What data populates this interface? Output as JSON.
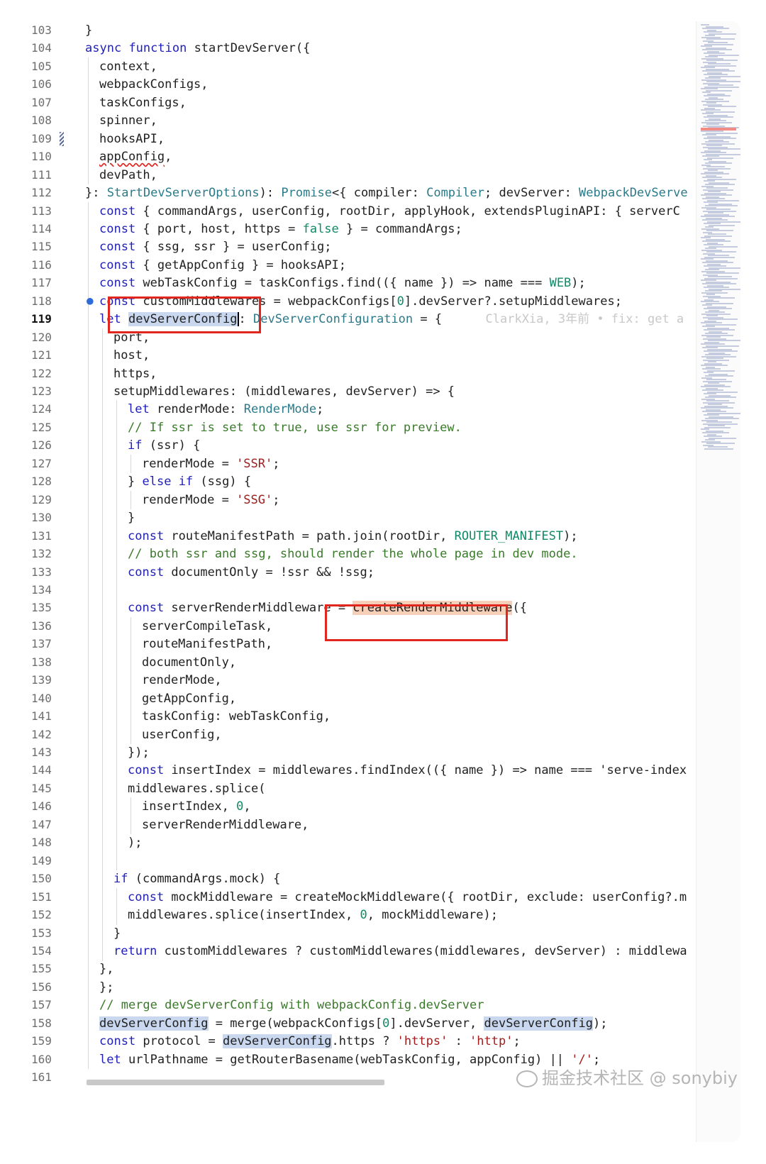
{
  "editor": {
    "active_line": 119,
    "blame": "ClarkXia, 3年前 • fix: get a",
    "lines": [
      {
        "n": 103,
        "i": 0,
        "t": "}"
      },
      {
        "n": 104,
        "i": 0,
        "t": "async function startDevServer({"
      },
      {
        "n": 105,
        "i": 1,
        "t": "context,"
      },
      {
        "n": 106,
        "i": 1,
        "t": "webpackConfigs,"
      },
      {
        "n": 107,
        "i": 1,
        "t": "taskConfigs,"
      },
      {
        "n": 108,
        "i": 1,
        "t": "spinner,"
      },
      {
        "n": 109,
        "i": 1,
        "t": "hooksAPI,"
      },
      {
        "n": 110,
        "i": 1,
        "t": "appConfig,"
      },
      {
        "n": 111,
        "i": 1,
        "t": "devPath,"
      },
      {
        "n": 112,
        "i": 0,
        "t": "}: StartDevServerOptions): Promise<{ compiler: Compiler; devServer: WebpackDevServe"
      },
      {
        "n": 113,
        "i": 1,
        "t": "const { commandArgs, userConfig, rootDir, applyHook, extendsPluginAPI: { serverC"
      },
      {
        "n": 114,
        "i": 1,
        "t": "const { port, host, https = false } = commandArgs;"
      },
      {
        "n": 115,
        "i": 1,
        "t": "const { ssg, ssr } = userConfig;"
      },
      {
        "n": 116,
        "i": 1,
        "t": "const { getAppConfig } = hooksAPI;"
      },
      {
        "n": 117,
        "i": 1,
        "t": "const webTaskConfig = taskConfigs.find(({ name }) => name === WEB);"
      },
      {
        "n": 118,
        "i": 1,
        "t": "const customMiddlewares = webpackConfigs[0].devServer?.setupMiddlewares;"
      },
      {
        "n": 119,
        "i": 1,
        "t": "let devServerConfig: DevServerConfiguration = {"
      },
      {
        "n": 120,
        "i": 2,
        "t": "port,"
      },
      {
        "n": 121,
        "i": 2,
        "t": "host,"
      },
      {
        "n": 122,
        "i": 2,
        "t": "https,"
      },
      {
        "n": 123,
        "i": 2,
        "t": "setupMiddlewares: (middlewares, devServer) => {"
      },
      {
        "n": 124,
        "i": 3,
        "t": "let renderMode: RenderMode;"
      },
      {
        "n": 125,
        "i": 3,
        "t": "// If ssr is set to true, use ssr for preview."
      },
      {
        "n": 126,
        "i": 3,
        "t": "if (ssr) {"
      },
      {
        "n": 127,
        "i": 4,
        "t": "renderMode = 'SSR';"
      },
      {
        "n": 128,
        "i": 3,
        "t": "} else if (ssg) {"
      },
      {
        "n": 129,
        "i": 4,
        "t": "renderMode = 'SSG';"
      },
      {
        "n": 130,
        "i": 3,
        "t": "}"
      },
      {
        "n": 131,
        "i": 3,
        "t": "const routeManifestPath = path.join(rootDir, ROUTER_MANIFEST);"
      },
      {
        "n": 132,
        "i": 3,
        "t": "// both ssr and ssg, should render the whole page in dev mode."
      },
      {
        "n": 133,
        "i": 3,
        "t": "const documentOnly = !ssr && !ssg;"
      },
      {
        "n": 134,
        "i": 3,
        "t": ""
      },
      {
        "n": 135,
        "i": 3,
        "t": "const serverRenderMiddleware = createRenderMiddleware({"
      },
      {
        "n": 136,
        "i": 4,
        "t": "serverCompileTask,"
      },
      {
        "n": 137,
        "i": 4,
        "t": "routeManifestPath,"
      },
      {
        "n": 138,
        "i": 4,
        "t": "documentOnly,"
      },
      {
        "n": 139,
        "i": 4,
        "t": "renderMode,"
      },
      {
        "n": 140,
        "i": 4,
        "t": "getAppConfig,"
      },
      {
        "n": 141,
        "i": 4,
        "t": "taskConfig: webTaskConfig,"
      },
      {
        "n": 142,
        "i": 4,
        "t": "userConfig,"
      },
      {
        "n": 143,
        "i": 3,
        "t": "});"
      },
      {
        "n": 144,
        "i": 3,
        "t": "const insertIndex = middlewares.findIndex(({ name }) => name === 'serve-index"
      },
      {
        "n": 145,
        "i": 3,
        "t": "middlewares.splice("
      },
      {
        "n": 146,
        "i": 4,
        "t": "insertIndex, 0,"
      },
      {
        "n": 147,
        "i": 4,
        "t": "serverRenderMiddleware,"
      },
      {
        "n": 148,
        "i": 3,
        "t": ");"
      },
      {
        "n": 149,
        "i": 3,
        "t": ""
      },
      {
        "n": 150,
        "i": 2,
        "t": "if (commandArgs.mock) {"
      },
      {
        "n": 151,
        "i": 3,
        "t": "const mockMiddleware = createMockMiddleware({ rootDir, exclude: userConfig?.m"
      },
      {
        "n": 152,
        "i": 3,
        "t": "middlewares.splice(insertIndex, 0, mockMiddleware);"
      },
      {
        "n": 153,
        "i": 2,
        "t": "}"
      },
      {
        "n": 154,
        "i": 2,
        "t": "return customMiddlewares ? customMiddlewares(middlewares, devServer) : middlewa"
      },
      {
        "n": 155,
        "i": 1,
        "t": "},"
      },
      {
        "n": 156,
        "i": 1,
        "t": "};"
      },
      {
        "n": 157,
        "i": 1,
        "t": "// merge devServerConfig with webpackConfig.devServer"
      },
      {
        "n": 158,
        "i": 1,
        "t": "devServerConfig = merge(webpackConfigs[0].devServer, devServerConfig);"
      },
      {
        "n": 159,
        "i": 1,
        "t": "const protocol = devServerConfig.https ? 'https' : 'http';"
      },
      {
        "n": 160,
        "i": 1,
        "t": "let urlPathname = getRouterBasename(webTaskConfig, appConfig) || '/';"
      },
      {
        "n": 161,
        "i": 0,
        "t": ""
      }
    ]
  },
  "watermark": "掘金技术社区 @ sonybiy",
  "colors": {
    "highlight_box": "#e0261f",
    "keyword": "#1f1fb8",
    "string": "#a11d1d",
    "comment": "#3a7a2a",
    "type": "#2b7a8a"
  }
}
